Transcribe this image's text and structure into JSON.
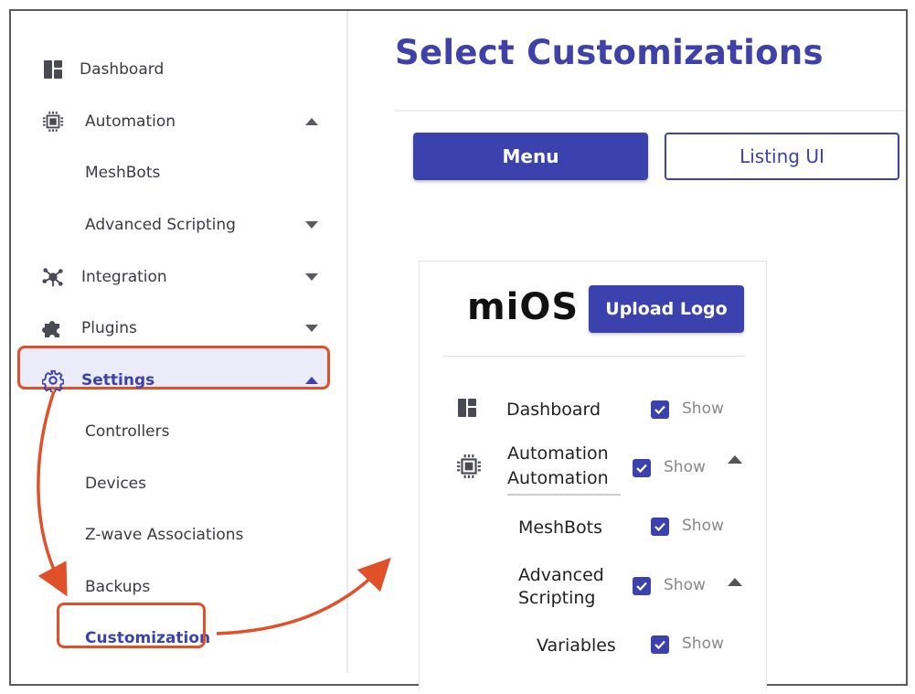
{
  "sidebar": {
    "dashboard": "Dashboard",
    "automation": "Automation",
    "meshbots": "MeshBots",
    "advanced_scripting": "Advanced Scripting",
    "integration": "Integration",
    "plugins": "Plugins",
    "settings": "Settings",
    "controllers": "Controllers",
    "devices": "Devices",
    "zwave": "Z-wave Associations",
    "backups": "Backups",
    "customization": "Customization"
  },
  "main": {
    "title": "Select Customizations",
    "tab_menu": "Menu",
    "tab_listing": "Listing UI"
  },
  "panel": {
    "logo": "miOS",
    "upload_logo": "Upload Logo",
    "rows": {
      "dashboard": "Dashboard",
      "automation_1": "Automation",
      "automation_2": "Automation",
      "meshbots": "MeshBots",
      "advanced_1": "Advanced",
      "advanced_2": "Scripting",
      "variables": "Variables"
    },
    "show": "Show"
  },
  "colors": {
    "accent": "#3c42ad",
    "highlight": "#e0512a",
    "selected_bg": "#ecebfa"
  },
  "icons": [
    "dashboard-icon",
    "automation-chip-icon",
    "integration-icon",
    "puzzle-icon",
    "gear-icon",
    "check-icon",
    "caret-up-icon",
    "caret-down-icon"
  ]
}
